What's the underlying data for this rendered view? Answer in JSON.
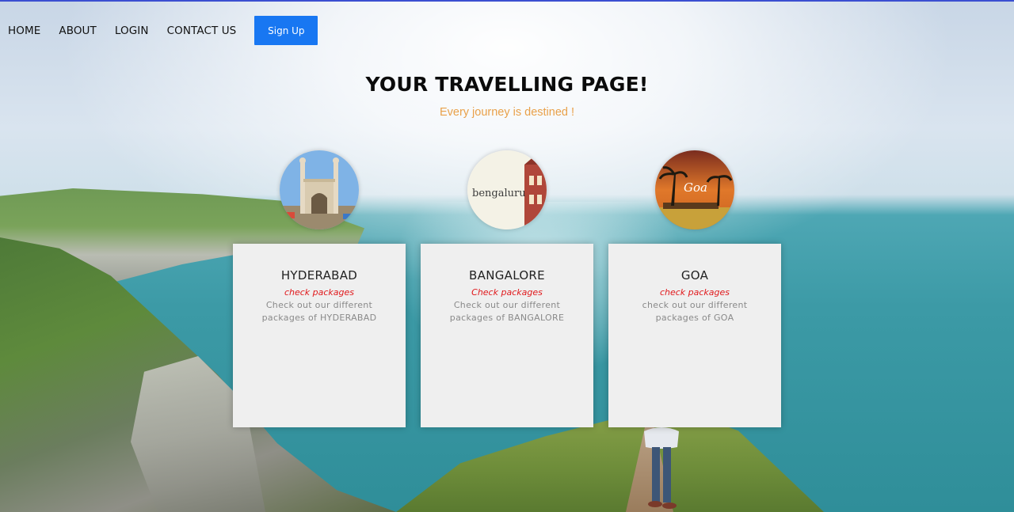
{
  "nav": {
    "items": [
      "HOME",
      "ABOUT",
      "LOGIN",
      "CONTACT US"
    ],
    "signup_label": "Sign Up",
    "signup_color": "#1877f2"
  },
  "hero": {
    "title": "YOUR TRAVELLING PAGE!",
    "subtitle": "Every journey is destined !"
  },
  "cards": [
    {
      "image_text": "",
      "city": "HYDERABAD",
      "link": "check packages",
      "desc": "Check out our different packages of HYDERABAD"
    },
    {
      "image_text": "bengaluru",
      "city": "BANGALORE",
      "link": "Check packages",
      "desc": "Check out our different packages of BANGALORE"
    },
    {
      "image_text": "Goa",
      "city": "GOA",
      "link": "check packages",
      "desc": "check out our different packages of GOA"
    }
  ],
  "colors": {
    "accent_link": "#e0191c",
    "subtitle": "#e9a14a"
  }
}
